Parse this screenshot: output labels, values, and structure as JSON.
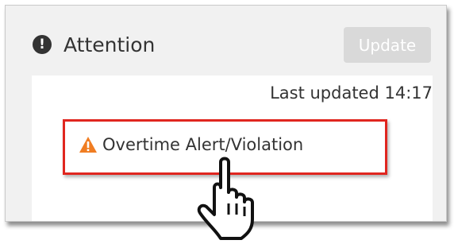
{
  "widget": {
    "title": "Attention",
    "title_icon": "exclamation-circle-icon",
    "update_label": "Update"
  },
  "content": {
    "last_updated": "Last updated 14:17",
    "alert": {
      "icon": "warning-triangle-icon",
      "label": "Overtime Alert/Violation",
      "icon_color": "#f07d22"
    }
  },
  "annotations": {
    "highlight_color": "#e0261f",
    "cursor": "hand-pointer-icon"
  }
}
